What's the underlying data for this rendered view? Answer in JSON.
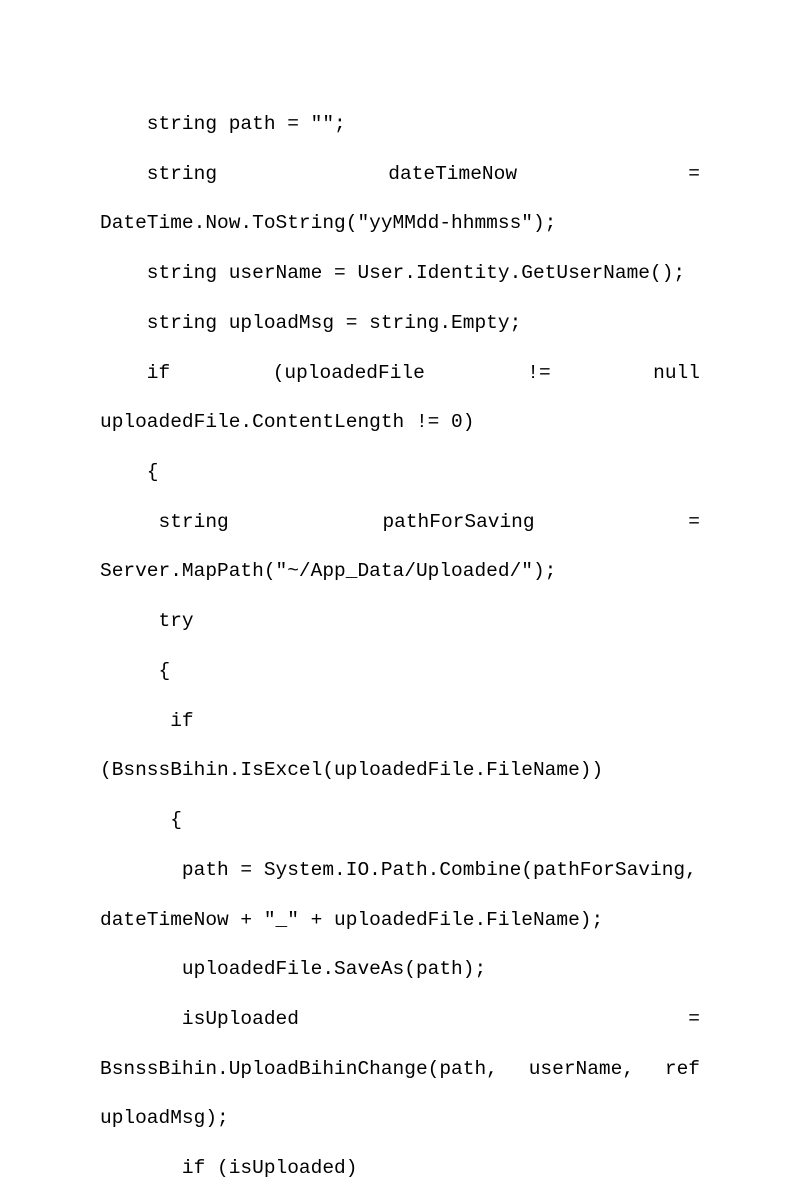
{
  "code": {
    "l01a": "    string path = \"\";",
    "l02a": "    string",
    "l02b": "dateTimeNow",
    "l02c": "=",
    "l03a": "DateTime.Now.ToString(\"yyMMdd-hhmmss\");",
    "l04a": "    string userName = User.Identity.GetUserName();",
    "l05a": "    string uploadMsg = string.Empty;",
    "l06a": "    if",
    "l06b": "(uploadedFile",
    "l06c": "!=",
    "l06d": "null",
    "l07a": "uploadedFile.ContentLength != 0)",
    "l08a": "    {",
    "l09a": "     string",
    "l09b": "pathForSaving",
    "l09c": "=",
    "l10a": "Server.MapPath(\"~/App_Data/Uploaded/\");",
    "l11a": "     try",
    "l12a": "     {",
    "l13a": "      if",
    "l14a": "(BsnssBihin.IsExcel(uploadedFile.FileName))",
    "l15a": "      {",
    "l16a": "       path = System.IO.Path.Combine(pathForSaving,",
    "l17a": "dateTimeNow + \"_\" + uploadedFile.FileName);",
    "l18a": "       uploadedFile.SaveAs(path);",
    "l19a": "       isUploaded",
    "l19b": "=",
    "l20a": "BsnssBihin.UploadBihinChange(path,",
    "l20b": "userName,",
    "l20c": "ref",
    "l21a": "uploadMsg);",
    "l22a": "       if (isUploaded)"
  }
}
